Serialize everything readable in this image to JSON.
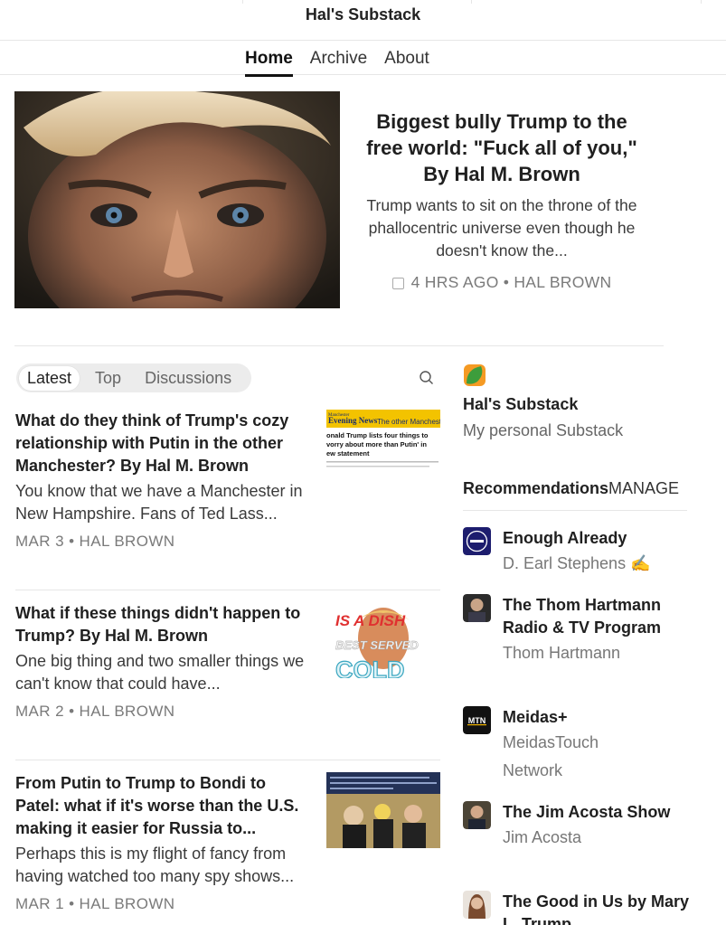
{
  "site": {
    "title": "Hal's Substack"
  },
  "nav": {
    "items": [
      "Home",
      "Archive",
      "About"
    ],
    "active": "Home"
  },
  "featured": {
    "title": "Biggest bully Trump to the free world: \"Fuck all of you,\" By Hal M. Brown",
    "subtitle": "Trump wants to sit on the throne of the phallocentric universe even though he doesn't know the...",
    "meta": "4 HRS AGO • HAL BROWN"
  },
  "feed_tabs": {
    "items": [
      "Latest",
      "Top",
      "Discussions"
    ],
    "active": "Latest"
  },
  "posts": [
    {
      "title": "What do they think of Trump's cozy relationship with Putin in the other Manchester? By Hal M. Brown",
      "subtitle": "You know that we have a Manchester in New Hampshire. Fans of Ted Lass...",
      "meta": "MAR 3 • HAL BROWN",
      "thumb_text": [
        "Manchester",
        "Evening News",
        "The other Manchester",
        "onald Trump lists four things to",
        "vorry about more than Putin' in",
        "ew statement"
      ]
    },
    {
      "title": "What if these things didn't happen to Trump? By Hal M. Brown",
      "subtitle": "One big thing and two smaller things we can't know that could have...",
      "meta": "MAR 2 • HAL BROWN",
      "thumb_text": [
        "IS A DISH",
        "BEST SERVED",
        "COLD"
      ]
    },
    {
      "title": "From Putin to Trump to Bondi to Patel: what if it's worse than the U.S. making it easier for Russia to...",
      "subtitle": "Perhaps this is my flight of fancy from having watched too many spy shows...",
      "meta": "MAR 1 • HAL BROWN",
      "thumb_text": []
    }
  ],
  "sidebar": {
    "pub_name": "Hal's Substack",
    "pub_desc": "My personal Substack",
    "rec_heading": "Recommendations",
    "manage_label": "MANAGE",
    "recommendations": [
      {
        "title": "Enough Already",
        "author": "D. Earl Stephens ✍️",
        "avatar": "enough-already-logo"
      },
      {
        "title": "The Thom Hartmann Radio & TV Program",
        "author": "Thom Hartmann",
        "avatar": "thom-hartmann-avatar"
      },
      {
        "title": "Meidas+",
        "author": "MeidasTouch Network",
        "avatar": "MTN"
      },
      {
        "title": "The Jim Acosta Show",
        "author": "Jim Acosta",
        "avatar": "jim-acosta-avatar"
      },
      {
        "title": "The Good in Us by Mary L. Trump",
        "author": "",
        "avatar": "mary-trump-avatar"
      }
    ]
  },
  "colors": {
    "accent": "#f59a23",
    "text": "#1f1f1f",
    "muted": "#7a7a7a"
  }
}
